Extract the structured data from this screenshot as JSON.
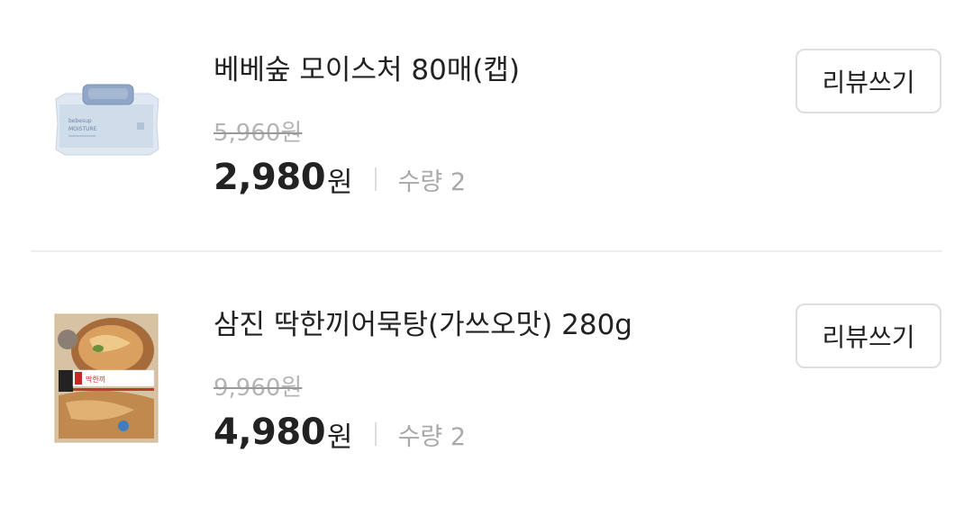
{
  "orders": [
    {
      "name": "베베숲 모이스처 80매(캡)",
      "original_price": "5,960원",
      "price": "2,980",
      "price_unit": "원",
      "quantity": "수량 2",
      "review_label": "리뷰쓰기",
      "thumbnail_text": "MOISTURE",
      "thumbnail_brand": "bebesup"
    },
    {
      "name": "삼진 딱한끼어묵탕(가쓰오맛) 280g",
      "original_price": "9,960원",
      "price": "4,980",
      "price_unit": "원",
      "quantity": "수량 2",
      "review_label": "리뷰쓰기",
      "thumbnail_text": "딱한끼"
    }
  ]
}
